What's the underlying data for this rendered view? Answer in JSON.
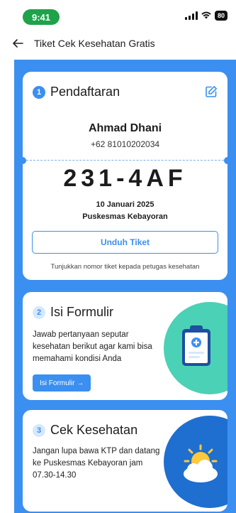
{
  "status_bar": {
    "time": "9:41",
    "battery": "80"
  },
  "header": {
    "title": "Tiket Cek Kesehatan Gratis"
  },
  "steps": {
    "registration": {
      "number": "1",
      "title": "Pendaftaran",
      "name": "Ahmad Dhani",
      "phone": "+62 81010202034",
      "ticket_code": "231-4AF",
      "date": "10 Januari 2025",
      "location": "Puskesmas Kebayoran",
      "download_label": "Unduh Tiket",
      "hint": "Tunjukkan nomor tiket kepada petugas kesehatan"
    },
    "form": {
      "number": "2",
      "title": "Isi Formulir",
      "description": "Jawab pertanyaan seputar kesehatan berikut agar kami bisa memahami kondisi Anda",
      "button_label": "Isi Formulir →"
    },
    "checkup": {
      "number": "3",
      "title": "Cek Kesehatan",
      "description": "Jangan lupa bawa KTP dan datang ke Puskesmas Kebayoran jam 07.30-14.30"
    }
  },
  "colors": {
    "primary": "#3b8ff0",
    "status_green": "#1ea24a",
    "deco_green": "#4bd1b5",
    "deco_blue": "#1e6fd0"
  }
}
